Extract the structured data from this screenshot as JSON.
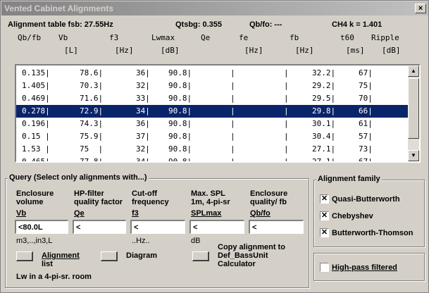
{
  "window": {
    "title": "Vented Cabinet Alignments",
    "close": "×"
  },
  "info": {
    "table_fsb": "Alignment table fsb:  27.55Hz",
    "qtsbg": "Qtsbg:  0.355",
    "qb_fo": "Qb/fo:  ---",
    "ch4": "CH4 k = 1.401"
  },
  "columns": [
    {
      "top": "Qb/fb",
      "bottom": ""
    },
    {
      "top": "Vb",
      "bottom": "[L]"
    },
    {
      "top": "f3",
      "bottom": "[Hz]"
    },
    {
      "top": "Lwmax",
      "bottom": "[dB]"
    },
    {
      "top": "Qe",
      "bottom": ""
    },
    {
      "top": "fe",
      "bottom": "[Hz]"
    },
    {
      "top": "fb",
      "bottom": "[Hz]"
    },
    {
      "top": "t60",
      "bottom": "[ms]"
    },
    {
      "top": "Ripple",
      "bottom": "[dB]"
    }
  ],
  "rows": [
    {
      "qbfb": "0.135|",
      "vb": "78.6|",
      "f3": "36|",
      "lw": "90.8|",
      "qe": "|",
      "fe": "|",
      "fb": "32.2|",
      "t60": "67|"
    },
    {
      "qbfb": "1.405|",
      "vb": "70.3|",
      "f3": "32|",
      "lw": "90.8|",
      "qe": "|",
      "fe": "|",
      "fb": "29.2|",
      "t60": "75|"
    },
    {
      "qbfb": "0.469|",
      "vb": "71.6|",
      "f3": "33|",
      "lw": "90.8|",
      "qe": "|",
      "fe": "|",
      "fb": "29.5|",
      "t60": "70|"
    },
    {
      "qbfb": "0.278|",
      "vb": "72.9|",
      "f3": "34|",
      "lw": "90.8|",
      "qe": "|",
      "fe": "|",
      "fb": "29.8|",
      "t60": "66|"
    },
    {
      "qbfb": "0.196|",
      "vb": "74.3|",
      "f3": "36|",
      "lw": "90.8|",
      "qe": "|",
      "fe": "|",
      "fb": "30.1|",
      "t60": "61|"
    },
    {
      "qbfb": "0.15 |",
      "vb": "75.9|",
      "f3": "37|",
      "lw": "90.8|",
      "qe": "|",
      "fe": "|",
      "fb": "30.4|",
      "t60": "57|"
    },
    {
      "qbfb": "1.53 |",
      "vb": "75  |",
      "f3": "32|",
      "lw": "90.8|",
      "qe": "|",
      "fe": "|",
      "fb": "27.1|",
      "t60": "73|"
    },
    {
      "qbfb": "0.465|",
      "vb": "77.8|",
      "f3": "34|",
      "lw": "90.8|",
      "qe": "|",
      "fe": "|",
      "fb": "27.1|",
      "t60": "67|"
    }
  ],
  "selected_row": 3,
  "scrollbar": {
    "up": "▲",
    "down": "▼"
  },
  "query": {
    "title": "Query (Select only alignments with...)",
    "fields": [
      {
        "label1": "Enclosure",
        "label2": "volume",
        "short": "Vb",
        "value": "<80.0L",
        "hint": "m3,..,in3,L"
      },
      {
        "label1": "HP-filter",
        "label2": "quality factor",
        "short": "Qe",
        "value": "<",
        "hint": ""
      },
      {
        "label1": "Cut-off",
        "label2": "frequency",
        "short": "f3",
        "value": "<",
        "hint": "..Hz.."
      },
      {
        "label1": "Max. SPL",
        "label2": "1m, 4-pi-sr",
        "short": "SPLmax",
        "value": "<",
        "hint": "dB"
      },
      {
        "label1": "Enclosure",
        "label2": "quality/ fb",
        "short": "Qb/fo",
        "value": "<",
        "hint": ""
      }
    ],
    "alignment_list_1": "Alignment",
    "alignment_list_2": "list",
    "diagram": "Diagram",
    "copy_1": "Copy alignment to",
    "copy_2": "Def_BassUnit",
    "copy_3": "Calculator",
    "footer": "Lw in a 4-pi-sr. room"
  },
  "family": {
    "title": "Alignment family",
    "items": [
      {
        "label": "Quasi-Butterworth",
        "checked": "✕"
      },
      {
        "label": "Chebyshev",
        "checked": "✕"
      },
      {
        "label": "Butterworth-Thomson",
        "checked": "✕"
      }
    ]
  },
  "highpass": {
    "label": "High-pass filtered",
    "checked": ""
  }
}
